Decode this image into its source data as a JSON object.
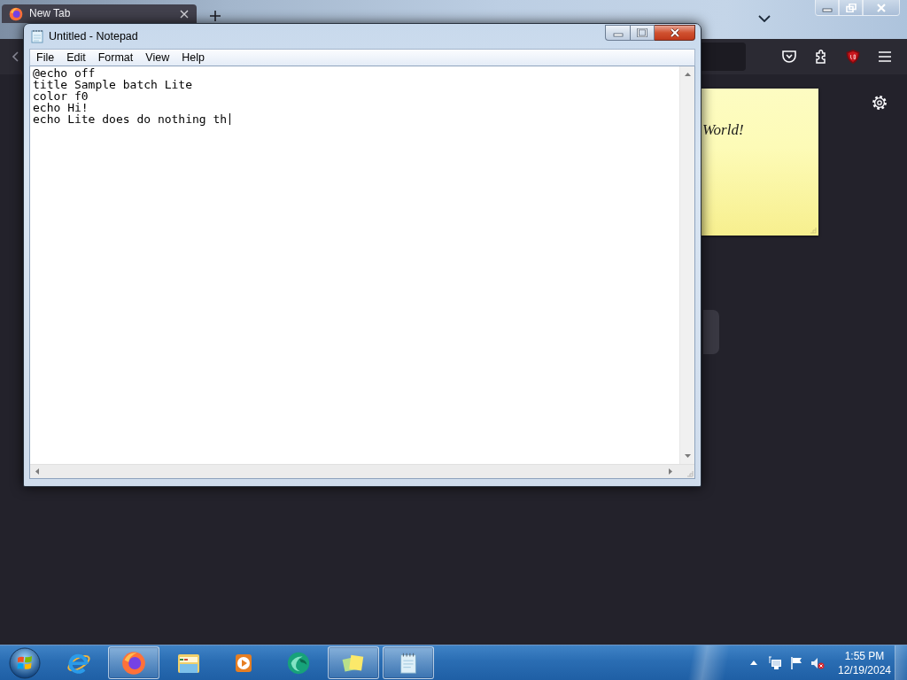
{
  "browser": {
    "tabs": [
      {
        "title": "New Tab",
        "selected": true
      }
    ]
  },
  "notepad": {
    "title": "Untitled - Notepad",
    "menu": [
      "File",
      "Edit",
      "Format",
      "View",
      "Help"
    ],
    "lines": [
      "@echo off",
      "title Sample batch Lite",
      "color f0",
      "echo Hi!",
      "echo Lite does do nothing th"
    ],
    "focused": true
  },
  "sticky_note": {
    "text": "World!"
  },
  "taskbar": {
    "items": [
      {
        "kind": "ebrowser",
        "running": false
      },
      {
        "kind": "foxbrowser",
        "running": true
      },
      {
        "kind": "folders",
        "running": false
      },
      {
        "kind": "player",
        "running": false
      },
      {
        "kind": "bubble",
        "running": false
      },
      {
        "kind": "notes",
        "running": true
      },
      {
        "kind": "notepad",
        "running": true
      }
    ],
    "clock": {
      "time": "1:55 PM",
      "date": "12/19/2024"
    }
  }
}
